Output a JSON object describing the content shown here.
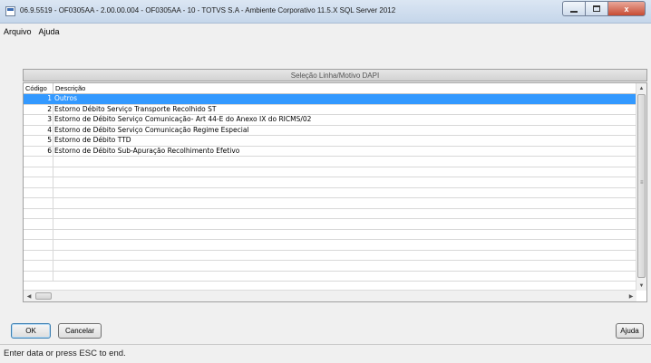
{
  "window": {
    "title": "06.9.5519 - OF0305AA - 2.00.00.004 - OF0305AA - 10 - TOTVS S.A - Ambiente Corporativo 11.5.X SQL Server 2012",
    "close_glyph": "x"
  },
  "menu": {
    "items": [
      "Arquivo",
      "Ajuda"
    ]
  },
  "panel": {
    "title": "Seleção Linha/Motivo DAPI",
    "columns": {
      "code": "Código",
      "description": "Descrição"
    },
    "rows": [
      {
        "code": "1",
        "description": "Outros"
      },
      {
        "code": "2",
        "description": "Estorno Débito Serviço Transporte Recolhido ST"
      },
      {
        "code": "3",
        "description": "Estorno de Débito Serviço Comunicação- Art 44-E do Anexo IX do RICMS/02"
      },
      {
        "code": "4",
        "description": "Estorno de Débito Serviço Comunicação  Regime Especial"
      },
      {
        "code": "5",
        "description": "Estorno de Débito TTD"
      },
      {
        "code": "6",
        "description": "Estorno de Débito Sub-Apuração  Recolhimento Efetivo"
      }
    ],
    "selected_row": 1
  },
  "buttons": {
    "ok": "OK",
    "cancel": "Cancelar",
    "help": "Ajuda"
  },
  "status": {
    "text": "Enter data or press ESC to end."
  },
  "colors": {
    "selection": "#3399ff",
    "title_bar": "#c5d6ea",
    "close_button": "#c74b33"
  }
}
